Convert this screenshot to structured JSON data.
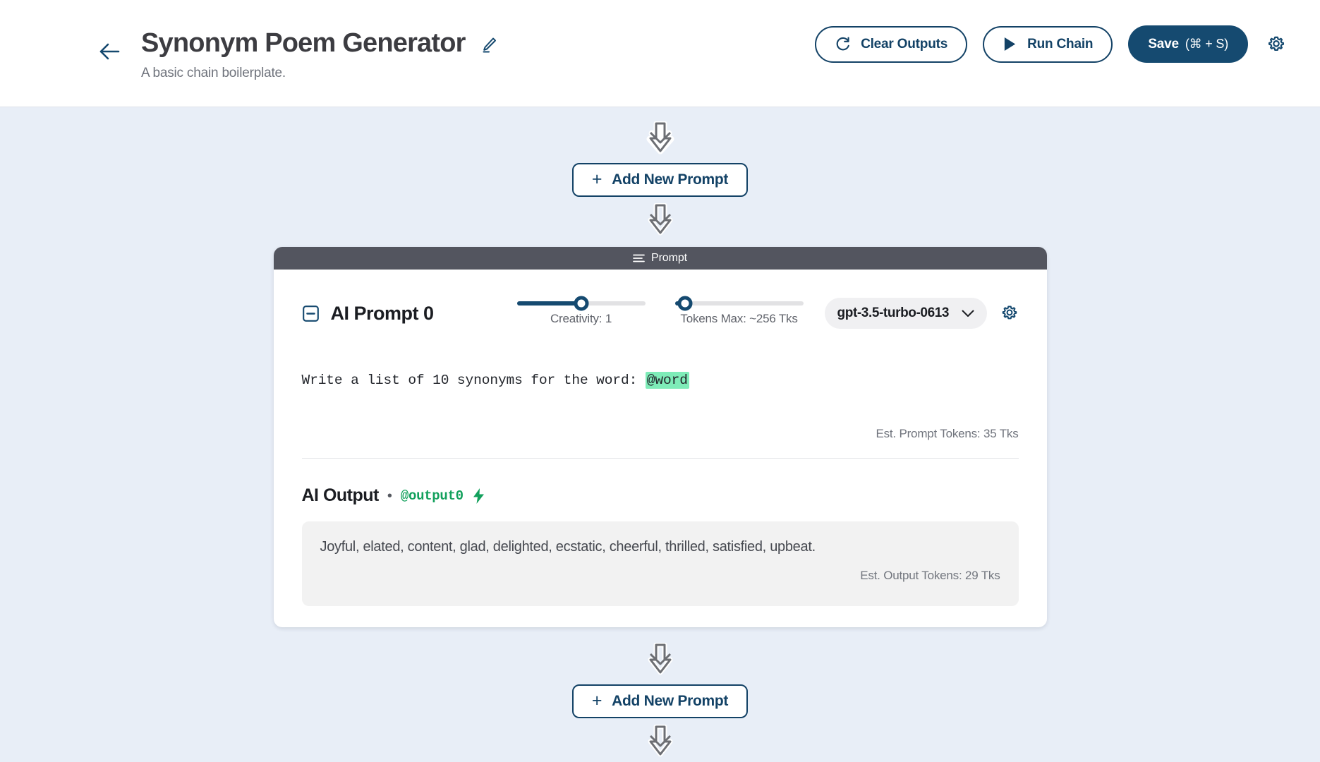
{
  "header": {
    "back_icon": "arrow-left-icon",
    "title": "Synonym Poem Generator",
    "subtitle": "A basic chain boilerplate.",
    "edit_icon": "pencil-icon",
    "settings_icon": "gear-icon",
    "buttons": {
      "clear_outputs": "Clear Outputs",
      "clear_outputs_icon": "refresh-icon",
      "run_chain": "Run Chain",
      "run_chain_icon": "play-icon",
      "save": "Save",
      "save_shortcut": "(⌘ + S)"
    }
  },
  "canvas": {
    "add_prompt_label": "Add New Prompt",
    "add_prompt_plus": "+",
    "arrow_icon": "arrow-down-icon"
  },
  "prompt_card": {
    "header_label": "Prompt",
    "header_icon": "drag-handle-icon",
    "collapse_icon": "minus-square-icon",
    "name": "AI Prompt 0",
    "creativity": {
      "label": "Creativity: 1",
      "value": 1,
      "percent": 50
    },
    "tokens_max": {
      "label": "Tokens Max: ~256 Tks",
      "value": 256,
      "percent": 8
    },
    "model": {
      "selected": "gpt-3.5-turbo-0613",
      "chevron_icon": "chevron-down-icon"
    },
    "settings_icon": "gear-icon",
    "prompt_text_before": "Write a list of 10 synonyms for the word: ",
    "prompt_variable": "@word",
    "prompt_tokens_note": "Est. Prompt Tokens: 35 Tks",
    "output": {
      "title": "AI Output",
      "separator": "•",
      "variable": "@output0",
      "bolt_icon": "lightning-bolt-icon",
      "text": "Joyful, elated, content, glad, delighted, ecstatic, cheerful, thrilled, satisfied, upbeat.",
      "tokens_note": "Est. Output Tokens: 29 Tks"
    }
  },
  "colors": {
    "page_background": "#e8eef7",
    "accent_navy": "#154a70",
    "card_header": "#53555f",
    "variable_highlight": "#7eecb8",
    "output_green": "#12a05c"
  }
}
